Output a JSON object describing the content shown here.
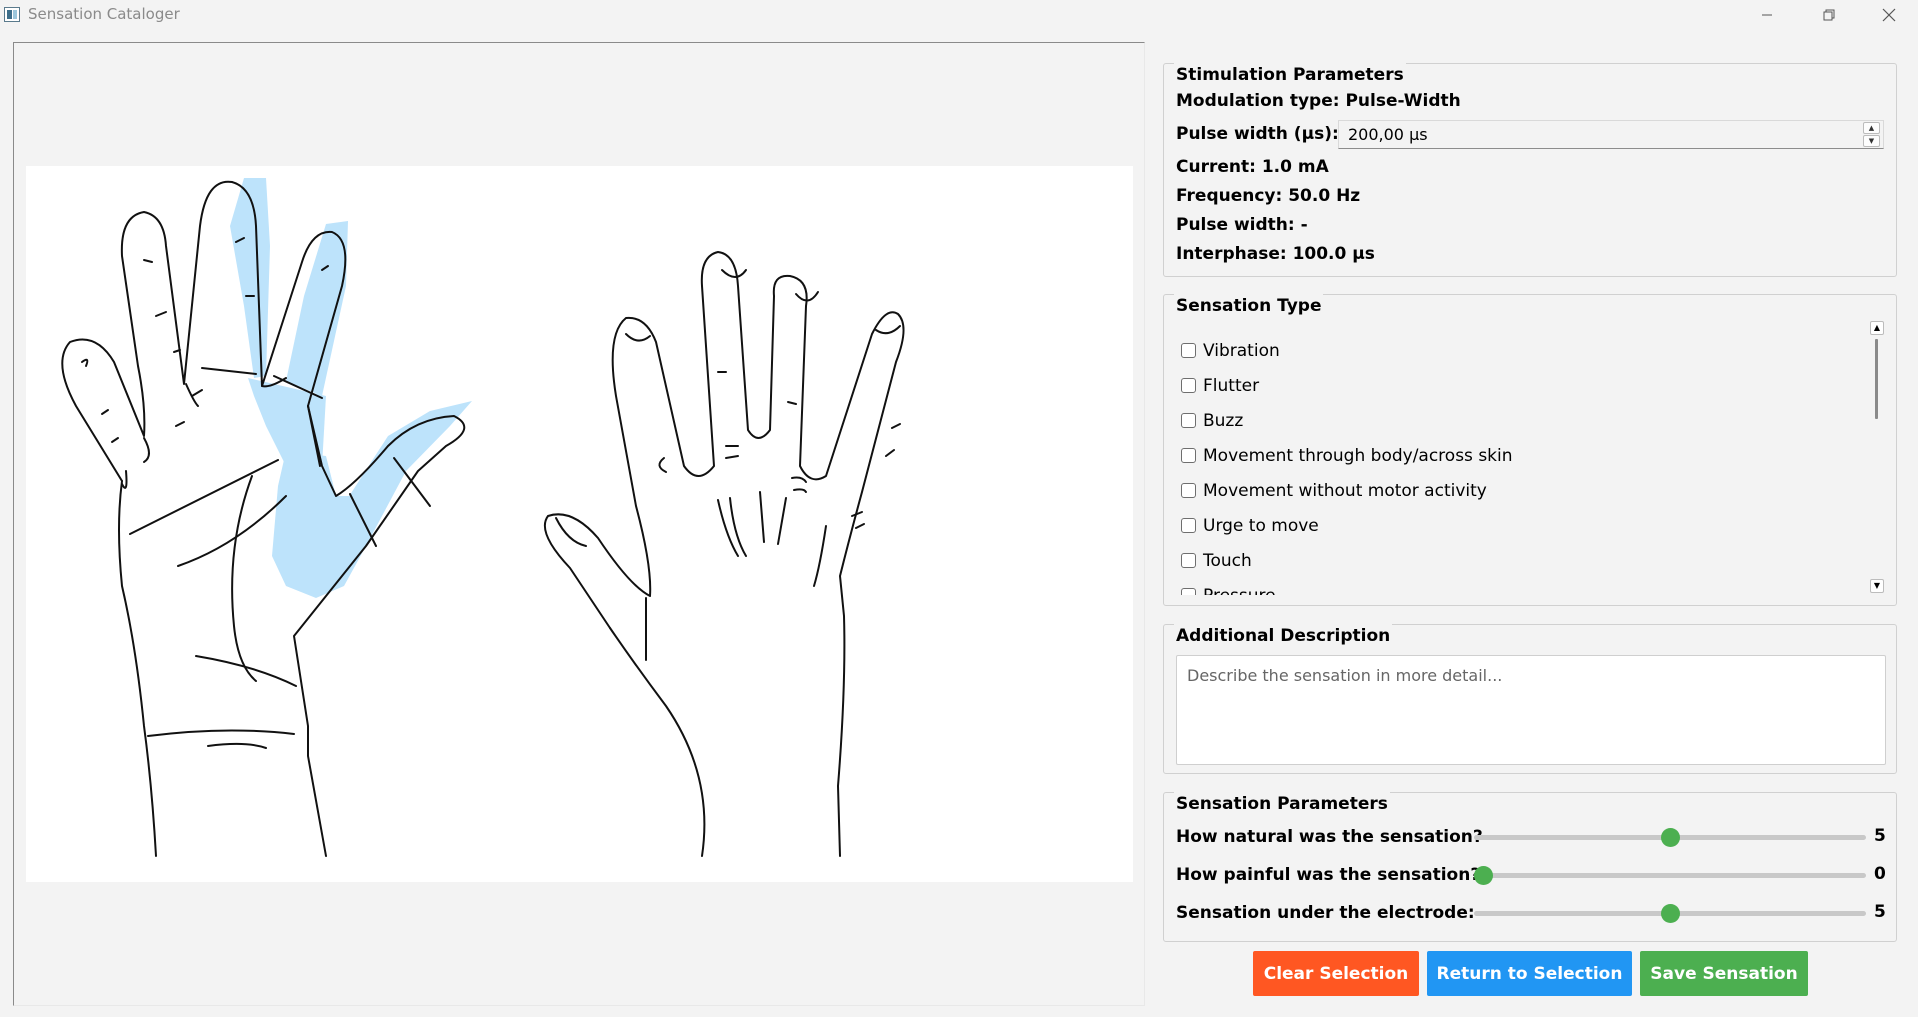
{
  "window": {
    "title": "Sensation Cataloger",
    "controls": [
      "minimize-icon",
      "restore-icon",
      "close-icon"
    ]
  },
  "stimulation": {
    "title": "Stimulation Parameters",
    "modulation": "Modulation type: Pulse-Width",
    "pulse_width_label": "Pulse width (μs):",
    "pulse_width_value": "200,00 μs",
    "current": "Current: 1.0 mA",
    "frequency": "Frequency: 50.0 Hz",
    "pulse_width_readout": "Pulse width: -",
    "interphase": "Interphase: 100.0 μs"
  },
  "sensation_type": {
    "title": "Sensation Type",
    "options": [
      {
        "label": "Vibration",
        "checked": false
      },
      {
        "label": "Flutter",
        "checked": false
      },
      {
        "label": "Buzz",
        "checked": false
      },
      {
        "label": "Movement through body/across skin",
        "checked": false
      },
      {
        "label": "Movement without motor activity",
        "checked": false
      },
      {
        "label": "Urge to move",
        "checked": false
      },
      {
        "label": "Touch",
        "checked": false
      },
      {
        "label": "Pressure",
        "checked": false
      }
    ]
  },
  "description": {
    "title": "Additional Description",
    "placeholder": "Describe the sensation in more detail..."
  },
  "sensation_params": {
    "title": "Sensation Parameters",
    "sliders": [
      {
        "label": "How natural was the sensation?",
        "value": "5",
        "fraction": 0.5
      },
      {
        "label": "How painful was the sensation?",
        "value": "0",
        "fraction": 0.0
      },
      {
        "label": "Sensation under the electrode:",
        "value": "5",
        "fraction": 0.5
      }
    ]
  },
  "buttons": {
    "clear": "Clear Selection",
    "return": "Return to Selection",
    "save": "Save Sensation"
  },
  "colors": {
    "clear": "#ff5722",
    "return": "#2196f3",
    "save": "#4caf50",
    "highlight": "#bde3fb",
    "slider_handle": "#4caf50"
  }
}
